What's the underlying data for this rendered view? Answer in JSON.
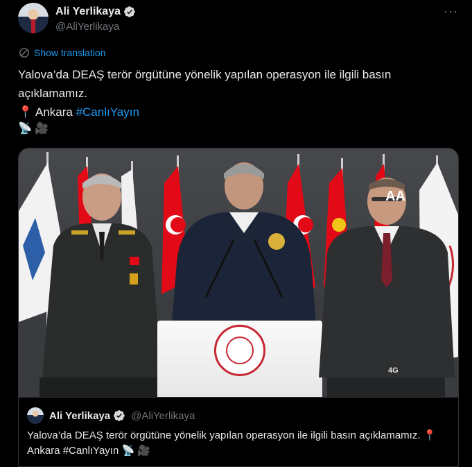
{
  "author": {
    "display_name": "Ali Yerlikaya",
    "handle": "@AliYerlikaya"
  },
  "more_label": "···",
  "translate_label": "Show translation",
  "tweet": {
    "text_part1": "Yalova’da DEAŞ terör örgütüne yönelik yapılan operasyon ile ilgili basın açıklamamız.",
    "pin": "📍",
    "location": "Ankara",
    "hashtag": "#CanlıYayın",
    "emoji_line": "📡 🎥"
  },
  "media": {
    "watermark": "AA",
    "channel_tag": "4G"
  },
  "quote": {
    "display_name": "Ali Yerlikaya",
    "handle": "@AliYerlikaya",
    "text": "Yalova’da DEAŞ terör örgütüne yönelik yapılan operasyon ile ilgili basın açıklamamız. 📍 Ankara #CanlıYayın 📡 🎥"
  },
  "colors": {
    "accent": "#1d9bf0",
    "text": "#e7e9ea",
    "muted": "#71767b",
    "turkish_red": "#e30a17"
  },
  "icons": [
    "verified-badge-icon",
    "translate-globe-icon",
    "more-icon"
  ]
}
